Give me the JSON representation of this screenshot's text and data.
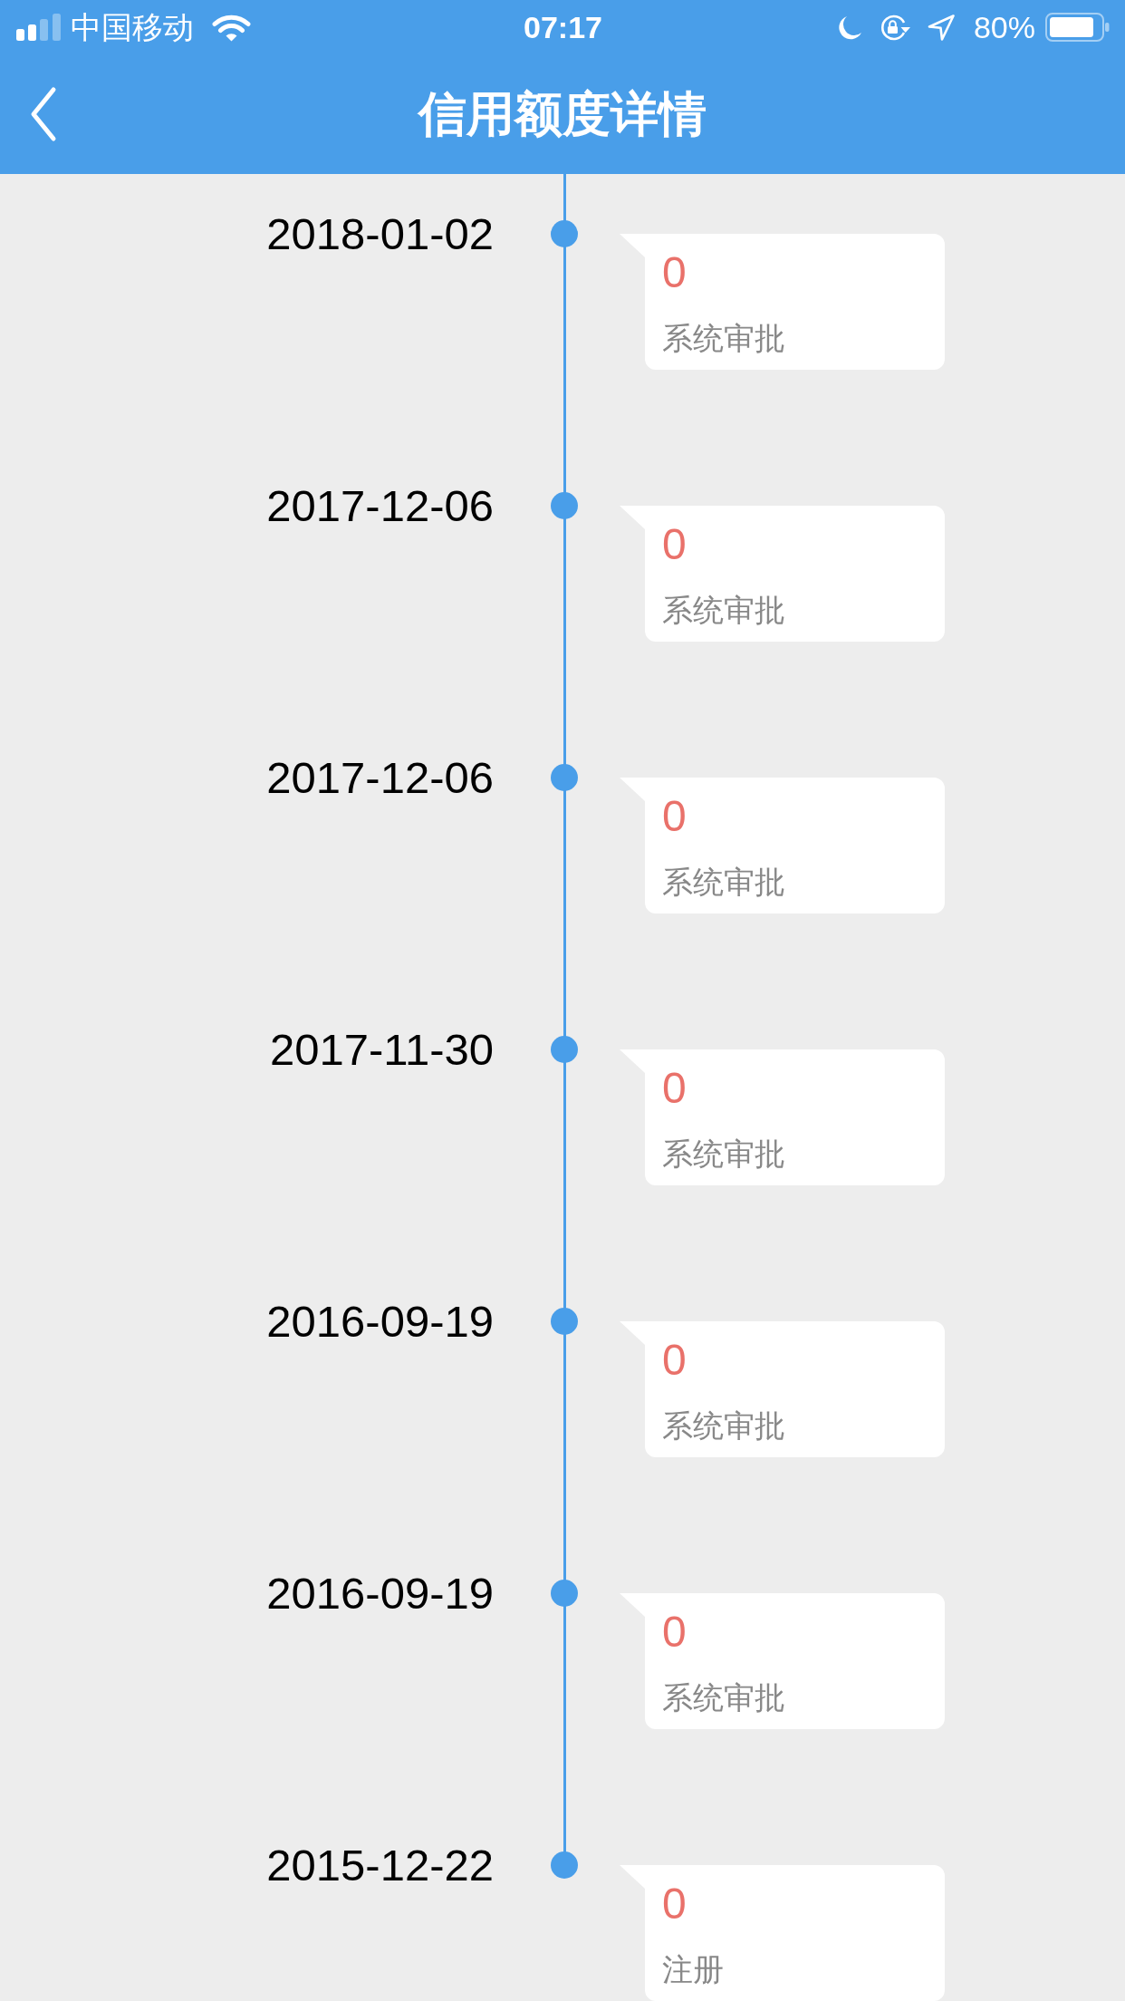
{
  "status_bar": {
    "carrier": "中国移动",
    "time": "07:17",
    "battery_percent": "80%"
  },
  "nav_bar": {
    "title": "信用额度详情"
  },
  "timeline": [
    {
      "date": "2018-01-02",
      "amount": "0",
      "description": "系统审批"
    },
    {
      "date": "2017-12-06",
      "amount": "0",
      "description": "系统审批"
    },
    {
      "date": "2017-12-06",
      "amount": "0",
      "description": "系统审批"
    },
    {
      "date": "2017-11-30",
      "amount": "0",
      "description": "系统审批"
    },
    {
      "date": "2016-09-19",
      "amount": "0",
      "description": "系统审批"
    },
    {
      "date": "2016-09-19",
      "amount": "0",
      "description": "系统审批"
    },
    {
      "date": "2015-12-22",
      "amount": "0",
      "description": "注册"
    }
  ]
}
